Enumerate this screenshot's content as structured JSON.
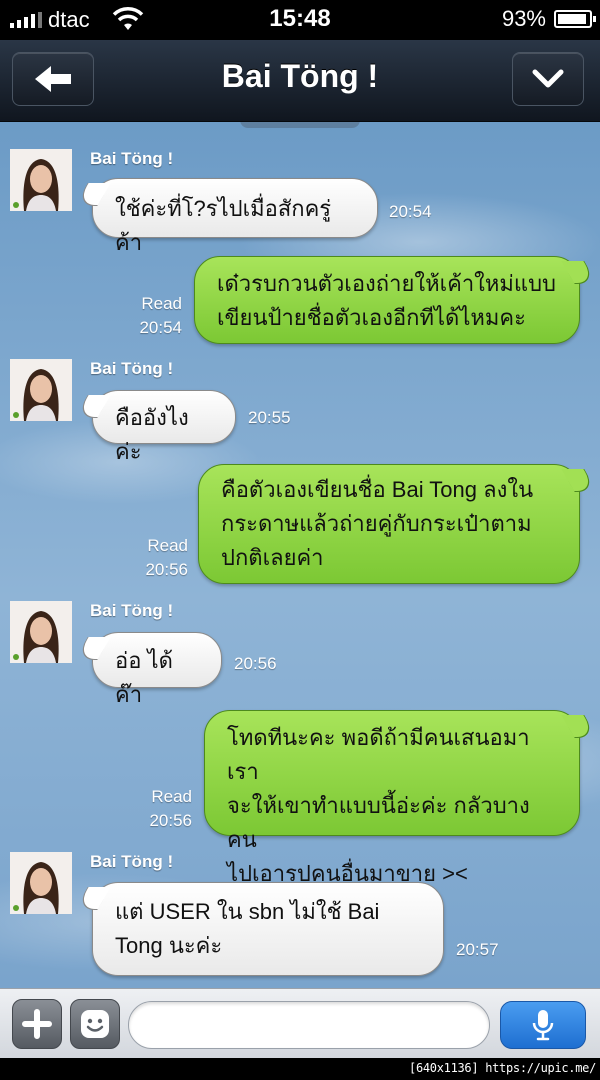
{
  "status_bar": {
    "carrier": "dtac",
    "time": "15:48",
    "battery": "93%"
  },
  "nav": {
    "title": "Bai Töng !"
  },
  "messages": [
    {
      "from": "Bai Töng !",
      "text": "ใช้ค่ะที่โ?รไปเมื่อสักครู่ค้า",
      "time": "20:54"
    },
    {
      "status": "Read",
      "text": "เด๋วรบกวนตัวเองถ่ายให้เค้าใหม่แบบ\nเขียนป้ายชื่อตัวเองอีกทีได้ไหมคะ",
      "time": "20:54"
    },
    {
      "from": "Bai Töng !",
      "text": "คืออังไงค่ะ",
      "time": "20:55"
    },
    {
      "status": "Read",
      "text": "คือตัวเองเขียนชื่อ Bai Tong ลงใน\nกระดาษแล้วถ่ายคู่กับกระเป๋าตาม\nปกติเลยค่า",
      "time": "20:56"
    },
    {
      "from": "Bai Töng !",
      "text": "อ่อ ได้ค๊า",
      "time": "20:56"
    },
    {
      "status": "Read",
      "text": "โทดทีนะคะ พอดีถ้ามีคนเสนอมาเรา\nจะให้เขาทำแบบนี้อ่ะค่ะ กลัวบางคน\nไปเอารุปคนอื่นมาขาย ><",
      "time": "20:56"
    },
    {
      "from": "Bai Töng !",
      "text": "แต่ USER ใน sbn ไม่ใช้ Bai\nTong นะค่ะ",
      "time": "20:57"
    }
  ],
  "input": {
    "placeholder": ""
  },
  "watermark": "[640x1136] https://upic.me/",
  "colors": {
    "outgoing_bubble": "#8fd646",
    "incoming_bubble": "#ffffff",
    "voice_button": "#2f84e0"
  },
  "icons": [
    "signal-icon",
    "wifi-icon",
    "battery-icon",
    "back-arrow-icon",
    "chevron-down-icon",
    "plus-icon",
    "smiley-icon",
    "microphone-icon"
  ]
}
